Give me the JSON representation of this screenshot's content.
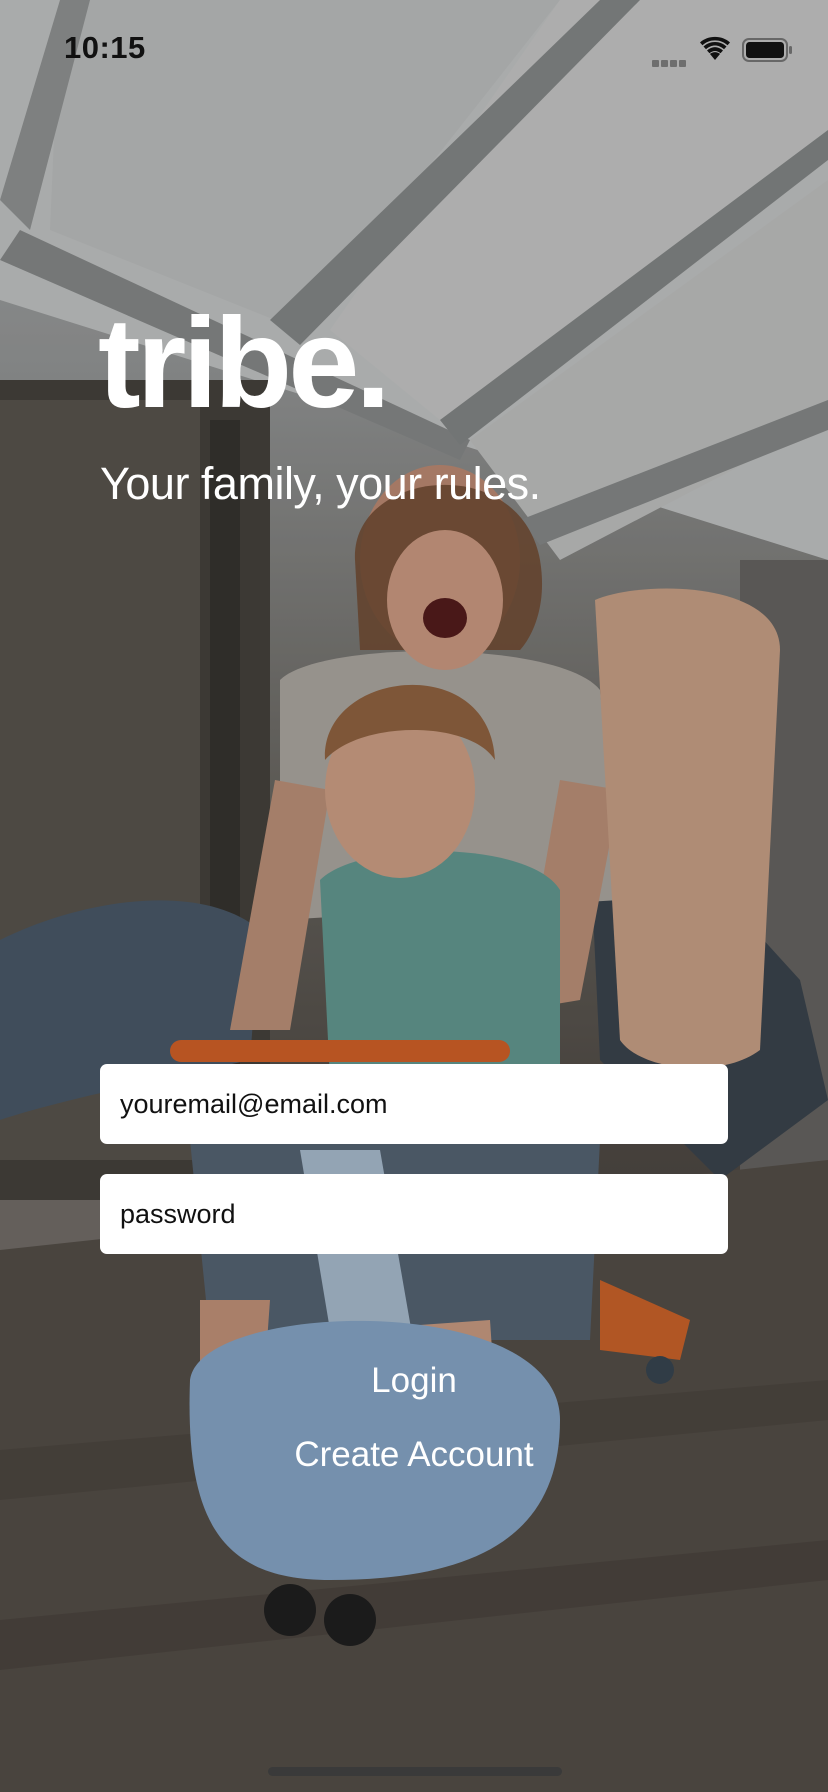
{
  "status_bar": {
    "time": "10:15"
  },
  "brand": {
    "title": "tribe.",
    "tagline": "Your family, your rules."
  },
  "login_form": {
    "email_placeholder": "youremail@email.com",
    "password_placeholder": "password"
  },
  "actions": {
    "login_label": "Login",
    "create_account_label": "Create Account"
  },
  "colors": {
    "text_on_photo": "#ffffff",
    "field_background": "#ffffff",
    "field_text": "#111111"
  },
  "icons": {
    "signal": "cellular-signal-icon",
    "wifi": "wifi-icon",
    "battery": "battery-icon"
  }
}
